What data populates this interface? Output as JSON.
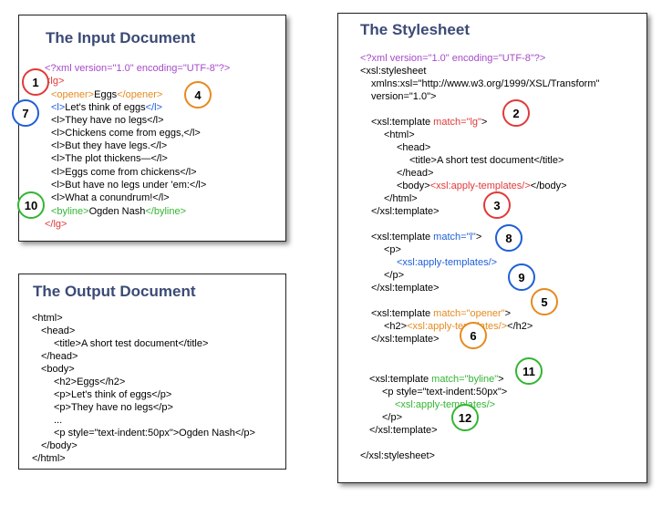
{
  "input_panel": {
    "title": "The Input Document",
    "lines": [
      [
        {
          "t": "<?xml version=\"1.0\" encoding=\"UTF-8\"?>",
          "c": "purple"
        }
      ],
      [
        {
          "t": "<lg>",
          "c": "red"
        }
      ],
      [
        {
          "t": "<opener>",
          "c": "orange"
        },
        {
          "t": "Eggs",
          "c": "black"
        },
        {
          "t": "</opener>",
          "c": "orange"
        }
      ],
      [
        {
          "t": "<l>",
          "c": "blue"
        },
        {
          "t": "Let's think of eggs",
          "c": "black"
        },
        {
          "t": "</l>",
          "c": "blue"
        }
      ],
      [
        {
          "t": "<l>They have no legs</l>",
          "c": "black"
        }
      ],
      [
        {
          "t": "<l>Chickens come from eggs,</l>",
          "c": "black"
        }
      ],
      [
        {
          "t": "<l>But they have legs.</l>",
          "c": "black"
        }
      ],
      [
        {
          "t": "<l>The plot thickens—</l>",
          "c": "black"
        }
      ],
      [
        {
          "t": "<l>Eggs come from chickens</l>",
          "c": "black"
        }
      ],
      [
        {
          "t": "<l>But have no legs under 'em:</l>",
          "c": "black"
        }
      ],
      [
        {
          "t": "<l>What a conundrum!</l>",
          "c": "black"
        }
      ],
      [
        {
          "t": "<byline>",
          "c": "green"
        },
        {
          "t": "Ogden Nash",
          "c": "black"
        },
        {
          "t": "</byline>",
          "c": "green"
        }
      ],
      [
        {
          "t": "</lg>",
          "c": "red"
        }
      ]
    ]
  },
  "output_panel": {
    "title": "The Output Document",
    "lines": [
      "<html>",
      "<head>",
      "<title>A short test document</title>",
      "</head>",
      "<body>",
      "<h2>Eggs</h2>",
      "<p>Let's think of eggs</p>",
      "<p>They have no legs</p>",
      "...",
      "<p style=\"text-indent:50px\">Ogden Nash</p>",
      "</body>",
      "</html>"
    ]
  },
  "stylesheet_panel": {
    "title": "The Stylesheet",
    "lines": [
      [
        {
          "t": "<?xml version=\"1.0\" encoding=\"UTF-8\"?>",
          "c": "purple"
        }
      ],
      [
        {
          "t": "<xsl:stylesheet",
          "c": "black"
        }
      ],
      [
        {
          "t": "xmlns:xsl=\"http://www.w3.org/1999/XSL/Transform\"",
          "c": "black"
        }
      ],
      [
        {
          "t": "version=\"1.0\">",
          "c": "black"
        }
      ],
      [],
      [
        {
          "t": "<xsl:template ",
          "c": "black"
        },
        {
          "t": "match=\"lg\"",
          "c": "red"
        },
        {
          "t": ">",
          "c": "black"
        }
      ],
      [
        {
          "t": "<html>",
          "c": "black"
        }
      ],
      [
        {
          "t": "<head>",
          "c": "black"
        }
      ],
      [
        {
          "t": "<title>A short test document</title>",
          "c": "black"
        }
      ],
      [
        {
          "t": "</head>",
          "c": "black"
        }
      ],
      [
        {
          "t": "<body>",
          "c": "black"
        },
        {
          "t": "<xsl:apply-templates/>",
          "c": "red"
        },
        {
          "t": "</body>",
          "c": "black"
        }
      ],
      [
        {
          "t": "</html>",
          "c": "black"
        }
      ],
      [
        {
          "t": "</xsl:template>",
          "c": "black"
        }
      ],
      [],
      [
        {
          "t": "<xsl:template ",
          "c": "black"
        },
        {
          "t": "match=\"l\"",
          "c": "blue"
        },
        {
          "t": ">",
          "c": "black"
        }
      ],
      [
        {
          "t": "<p>",
          "c": "black"
        }
      ],
      [
        {
          "t": "<xsl:apply-templates/>",
          "c": "blue"
        }
      ],
      [
        {
          "t": "</p>",
          "c": "black"
        }
      ],
      [
        {
          "t": "</xsl:template>",
          "c": "black"
        }
      ],
      [],
      [
        {
          "t": "<xsl:template ",
          "c": "black"
        },
        {
          "t": "match=\"opener\"",
          "c": "orange"
        },
        {
          "t": ">",
          "c": "black"
        }
      ],
      [
        {
          "t": "<h2>",
          "c": "black"
        },
        {
          "t": "<xsl:apply-templates/>",
          "c": "orange"
        },
        {
          "t": "</h2>",
          "c": "black"
        }
      ],
      [
        {
          "t": "</xsl:template>",
          "c": "black"
        }
      ],
      [],
      [],
      [
        {
          "t": "<xsl:template ",
          "c": "black"
        },
        {
          "t": "match=\"byline\"",
          "c": "green"
        },
        {
          "t": ">",
          "c": "black"
        }
      ],
      [
        {
          "t": "<p style=\"text-indent:50px\">",
          "c": "black"
        }
      ],
      [
        {
          "t": "<xsl:apply-templates/>",
          "c": "green"
        }
      ],
      [
        {
          "t": "</p>",
          "c": "black"
        }
      ],
      [
        {
          "t": "</xsl:template>",
          "c": "black"
        }
      ],
      [],
      [
        {
          "t": "</xsl:stylesheet>",
          "c": "black"
        }
      ]
    ]
  },
  "badges": [
    {
      "label": "1",
      "color": "red"
    },
    {
      "label": "7",
      "color": "blue"
    },
    {
      "label": "10",
      "color": "green"
    },
    {
      "label": "4",
      "color": "orange"
    },
    {
      "label": "2",
      "color": "red"
    },
    {
      "label": "3",
      "color": "red"
    },
    {
      "label": "8",
      "color": "blue"
    },
    {
      "label": "9",
      "color": "blue"
    },
    {
      "label": "5",
      "color": "orange"
    },
    {
      "label": "6",
      "color": "orange"
    },
    {
      "label": "11",
      "color": "green"
    },
    {
      "label": "12",
      "color": "green"
    }
  ]
}
